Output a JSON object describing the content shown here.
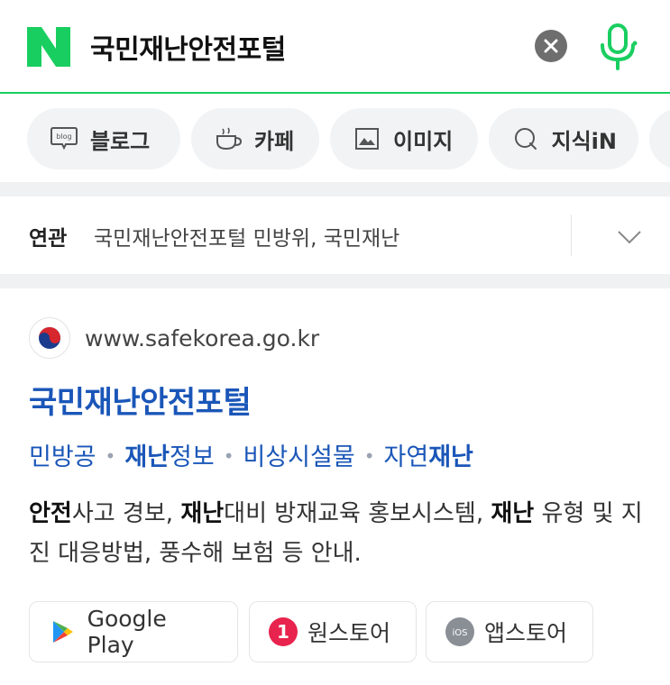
{
  "search": {
    "query": "국민재난안전포털",
    "logo_icon": "naver-n-logo",
    "brand_color": "#19ce60"
  },
  "chips": [
    {
      "label": "블로그",
      "icon": "blog-icon"
    },
    {
      "label": "카페",
      "icon": "cup-icon"
    },
    {
      "label": "이미지",
      "icon": "image-icon"
    },
    {
      "label": "지식iN",
      "icon": "search-q-icon"
    }
  ],
  "related": {
    "label": "연관",
    "text": "국민재난안전포털 민방위, 국민재난"
  },
  "result": {
    "url": "www.safekorea.go.kr",
    "title": "국민재난안전포털",
    "sublinks": [
      {
        "plain": "민방공",
        "bold": ""
      },
      {
        "bold": "재난",
        "plain": "정보"
      },
      {
        "plain": "비상시설물",
        "bold": ""
      },
      {
        "plain": "자연",
        "bold": "재난"
      }
    ],
    "desc": {
      "p1_bold": "안전",
      "p1": "사고 경보, ",
      "p2_bold": "재난",
      "p2": "대비 방재교육 홍보시스템, ",
      "p3_bold": "재난",
      "p3": " 유형 및 지진 대응방법, 풍수해 보험 등 안내."
    }
  },
  "stores": [
    {
      "label": "Google Play",
      "icon": "google-play-icon"
    },
    {
      "label": "원스토어",
      "icon": "onestore-icon",
      "icon_text": "1"
    },
    {
      "label": "앱스토어",
      "icon": "ios-icon",
      "icon_text": "iOS"
    }
  ],
  "colors": {
    "link_blue": "#1a56b8",
    "chip_bg": "#f1f3f5"
  }
}
